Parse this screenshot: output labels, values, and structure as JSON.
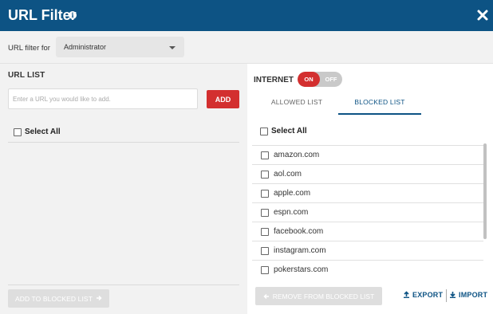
{
  "header": {
    "title": "URL Filter",
    "info_icon": "info-icon",
    "close_icon": "close-icon",
    "bg_color": "#0d5384"
  },
  "filter": {
    "label": "URL filter for",
    "selected": "Administrator"
  },
  "url_list": {
    "title": "URL LIST",
    "input_placeholder": "Enter a URL you would like to add.",
    "add_label": "ADD",
    "select_all_label": "Select All",
    "add_to_blocked_label": "ADD TO BLOCKED LIST"
  },
  "internet": {
    "label": "INTERNET",
    "on_label": "ON",
    "off_label": "OFF",
    "state": "on"
  },
  "tabs": [
    {
      "label": "ALLOWED LIST",
      "active": false
    },
    {
      "label": "BLOCKED LIST",
      "active": true
    }
  ],
  "blocked": {
    "select_all_label": "Select All",
    "items": [
      "amazon.com",
      "aol.com",
      "apple.com",
      "espn.com",
      "facebook.com",
      "instagram.com",
      "pokerstars.com"
    ],
    "remove_label": "REMOVE FROM BLOCKED LIST",
    "export_label": "EXPORT",
    "import_label": "IMPORT"
  },
  "colors": {
    "accent": "#d32f2f",
    "brand": "#0d5384"
  }
}
